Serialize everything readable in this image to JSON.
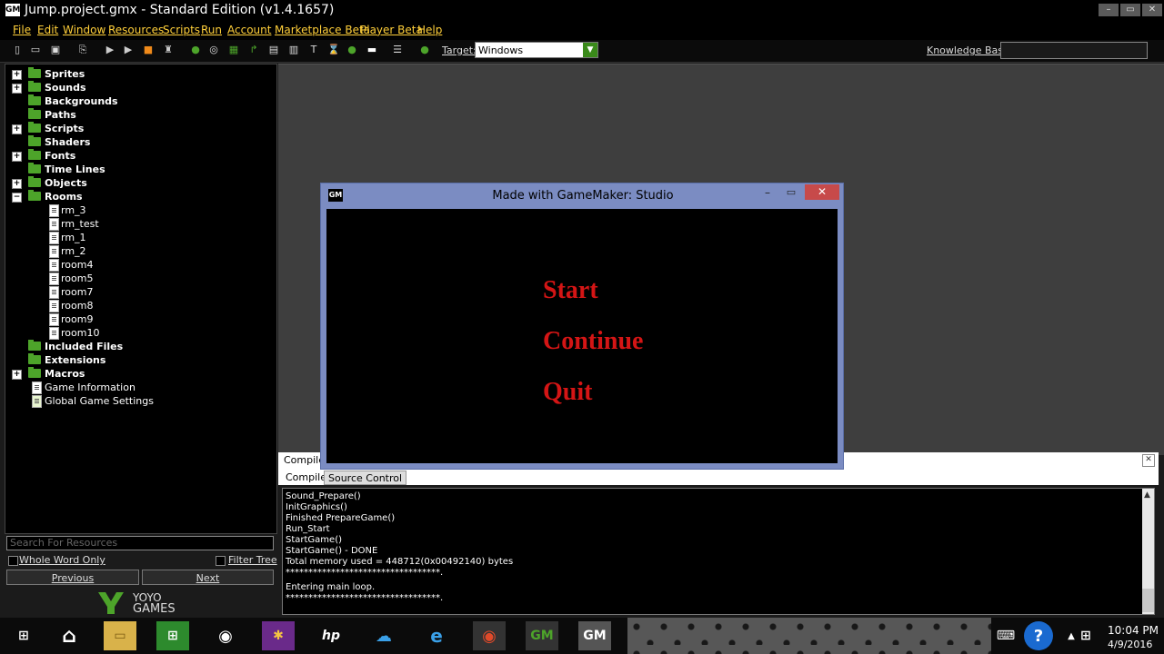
{
  "window": {
    "title": "Jump.project.gmx  -  Standard Edition (v1.4.1657)",
    "logo": "GM",
    "min_label": "–",
    "max_label": "▭",
    "close_label": "✕"
  },
  "menu": [
    "File",
    "Edit",
    "Window",
    "Resources",
    "Scripts",
    "Run",
    "Account",
    "Marketplace Beta",
    "Player Beta",
    "Help"
  ],
  "toolbar": {
    "target_label": "Target:",
    "target_value": "Windows",
    "knowledge_base_label": "Knowledge Base:",
    "icons": [
      "new-icon",
      "open-icon",
      "save-icon",
      "export-icon",
      "run-icon",
      "debug-icon",
      "stop-icon",
      "clean-icon",
      "sprite-icon",
      "sound-icon",
      "background-icon",
      "path-icon",
      "script-icon",
      "shader-icon",
      "font-icon",
      "timeline-icon",
      "object-icon",
      "room-icon",
      "settings-icon",
      "help-icon"
    ]
  },
  "tree": [
    {
      "label": "Sprites",
      "type": "folder",
      "plus": true
    },
    {
      "label": "Sounds",
      "type": "folder",
      "plus": true
    },
    {
      "label": "Backgrounds",
      "type": "folder",
      "plus": false
    },
    {
      "label": "Paths",
      "type": "folder",
      "plus": false
    },
    {
      "label": "Scripts",
      "type": "folder",
      "plus": true
    },
    {
      "label": "Shaders",
      "type": "folder",
      "plus": false
    },
    {
      "label": "Fonts",
      "type": "folder",
      "plus": true
    },
    {
      "label": "Time Lines",
      "type": "folder",
      "plus": false
    },
    {
      "label": "Objects",
      "type": "folder",
      "plus": true
    },
    {
      "label": "Rooms",
      "type": "folder",
      "plus": true
    },
    {
      "label": "rm_3",
      "type": "room"
    },
    {
      "label": "rm_test",
      "type": "room"
    },
    {
      "label": "rm_1",
      "type": "room"
    },
    {
      "label": "rm_2",
      "type": "room"
    },
    {
      "label": "room4",
      "type": "room"
    },
    {
      "label": "room5",
      "type": "room"
    },
    {
      "label": "room7",
      "type": "room"
    },
    {
      "label": "room8",
      "type": "room"
    },
    {
      "label": "room9",
      "type": "room"
    },
    {
      "label": "room10",
      "type": "room"
    },
    {
      "label": "Included Files",
      "type": "folder",
      "plus": false
    },
    {
      "label": "Extensions",
      "type": "folder",
      "plus": false
    },
    {
      "label": "Macros",
      "type": "folder",
      "plus": true
    },
    {
      "label": "Game Information",
      "type": "info"
    },
    {
      "label": "Global Game Settings",
      "type": "settings"
    }
  ],
  "search": {
    "placeholder": "Search For Resources",
    "whole_word": "Whole Word Only",
    "filter_tree": "Filter Tree",
    "previous": "Previous",
    "next": "Next"
  },
  "branding": {
    "yoyo_top": "YOYO",
    "yoyo_bottom": "GAMES"
  },
  "compile": {
    "title": "Compile",
    "close": "✕",
    "tabs": [
      "Compile",
      "Source Control"
    ],
    "log": [
      "Sound_Prepare()",
      "InitGraphics()",
      "Finished PrepareGame()",
      "Run_Start",
      "StartGame()",
      "StartGame() - DONE",
      "Total memory used = 448712(0x00492140) bytes",
      "**********************************.",
      "Entering main loop.",
      "**********************************."
    ]
  },
  "game_window": {
    "title": "Made with GameMaker: Studio",
    "logo": "GM",
    "options": [
      "Start",
      "Continue",
      "Quit"
    ]
  },
  "taskbar": {
    "time": "10:04 PM",
    "date": "4/9/2016",
    "help": "?"
  },
  "colors": {
    "menu_text": "#ffcf3a",
    "folder": "#4da42a",
    "game_text": "#d41515",
    "game_window_frame": "#7b8cc2"
  }
}
